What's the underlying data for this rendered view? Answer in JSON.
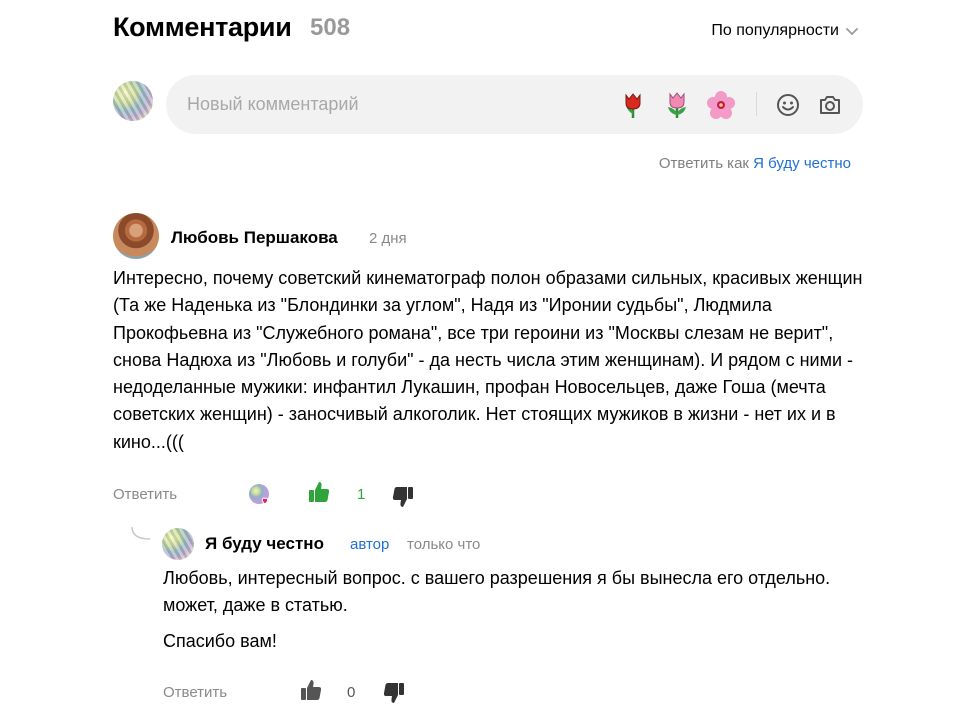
{
  "header": {
    "title": "Комментарии",
    "count": "508",
    "sort_label": "По популярности"
  },
  "compose": {
    "placeholder": "Новый комментарий",
    "emojis": [
      "tulip-red-icon",
      "tulip-pink-icon",
      "hibiscus-icon"
    ],
    "tools": [
      "smiley-icon",
      "camera-icon"
    ]
  },
  "reply_as": {
    "prefix": "Ответить как",
    "name": "Я буду честно"
  },
  "comment": {
    "author": "Любовь Першакова",
    "time": "2 дня",
    "text": "Интересно, почему советский кинематограф полон образами сильных, красивых женщин (Та же Наденька из \"Блондинки за углом\", Надя из \"Иронии судьбы\", Людмила Прокофьевна из \"Служебного романа\", все три героини из \"Москвы слезам не верит\", снова Надюха из \"Любовь и голуби\" - да несть числа этим женщинам). И рядом с ними - недоделанные мужики: инфантил Лукашин, профан Новосельцев, даже Гоша (мечта советских женщин) - заносчивый алкоголик. Нет стоящих мужиков в жизни - нет их и в кино...(((",
    "reply_label": "Ответить",
    "likes": "1",
    "like_color": "#2ea43b"
  },
  "reply": {
    "author": "Я буду честно",
    "badge": "автор",
    "time": "только что",
    "lines": [
      "Любовь, интересный вопрос. с вашего разрешения я бы вынесла его отдельно. может, даже в статью.",
      "Спасибо вам!"
    ],
    "reply_label": "Ответить",
    "likes": "0"
  },
  "colors": {
    "link": "#1f6fd6",
    "muted": "#8a8a8a",
    "icon_dark": "#333333"
  }
}
